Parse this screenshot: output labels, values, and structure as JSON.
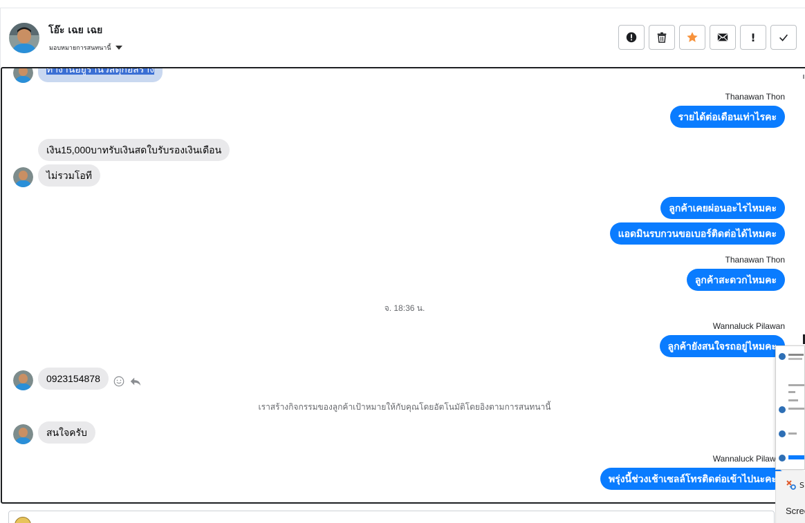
{
  "header": {
    "contact_name": "โอ๊ะ เฉย เฉย",
    "assign_label": "มอบหมายการสนทนานี้",
    "actions": [
      {
        "name": "mark-spam",
        "icon": "exclamation-circle-icon"
      },
      {
        "name": "delete",
        "icon": "trash-icon"
      },
      {
        "name": "star",
        "icon": "star-icon",
        "color": "#f7923b"
      },
      {
        "name": "mark-unread",
        "icon": "envelope-icon"
      },
      {
        "name": "follow-up",
        "icon": "exclamation-icon",
        "label": "!"
      },
      {
        "name": "done",
        "icon": "checkmark-icon"
      }
    ]
  },
  "chat": {
    "partial_top_text": "ทำงานอยู่ร้านวัสดุก่อสร้าง",
    "messages": {
      "sender_thanawan": "Thanawan Thon",
      "sender_wannaluck": "Wannaluck Pilawan",
      "out_1": "รายได้ต่อเดือนเท่าไรคะ",
      "in_1": "เงิน15,000บาทรับเงินสดใบรับรองเงินเดือน",
      "in_2": "ไม่รวมโอที",
      "out_2": "ลูกค้าเคยผ่อนอะไรไหมคะ",
      "out_3": "แอดมินรบกวนขอเบอร์ติดต่อได้ไหมคะ",
      "out_4": "ลูกค้าสะดวกไหมคะ",
      "timestamp": "จ. 18:36 น.",
      "out_5": "ลูกค้ายังสนใจรถอยู่ไหมคะ",
      "in_3": "0923154878",
      "system_note": "เราสร้างกิจกรรมของลูกค้าเป้าหมายให้กับคุณโดยอัตโนมัติโดยอิงตามการสนทนานี้",
      "in_4": "สนใจครับ",
      "out_6": "พรุ่งนี้ช่วงเช้าเซลล์โทรติดต่อเข้าไปนะคะ"
    }
  },
  "snip_panel": {
    "label_cut": "S",
    "text_cut": "Scree"
  },
  "colors": {
    "outgoing_bubble": "#0a7cff",
    "incoming_bubble": "#e9e9eb",
    "star_active": "#f7923b"
  }
}
